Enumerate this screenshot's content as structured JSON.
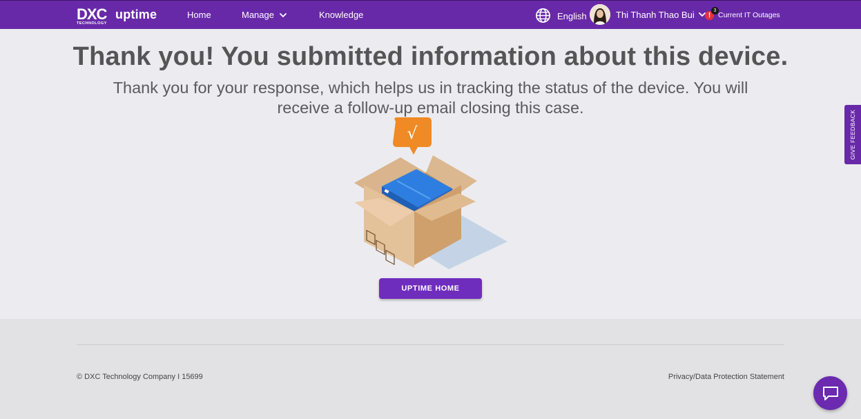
{
  "header": {
    "logo_brand": "DXC",
    "logo_sub": "TECHNOLOGY",
    "logo_product": "uptime",
    "nav": {
      "home": "Home",
      "manage": "Manage",
      "knowledge": "Knowledge"
    },
    "language": "English",
    "user_name": "Thi Thanh Thao Bui",
    "alert_glyph": "!",
    "alert_count": "3",
    "outages_label": "Current IT Outages",
    "icons": {
      "globe": "globe-icon",
      "manage_chevron": "chevron-down-icon",
      "user_chevron": "chevron-down-icon",
      "alert": "alert-icon"
    }
  },
  "main": {
    "title": "Thank you! You submitted information about this device.",
    "subtitle": "Thank you for your response, which helps us in tracking the status of the device. You will receive a follow-up email closing this case.",
    "check_glyph": "√",
    "button_label": "UPTIME HOME"
  },
  "feedback": {
    "label": "GIVE FEEDBACK"
  },
  "footer": {
    "copyright": "© DXC Technology Company I 15699",
    "privacy": "Privacy/Data Protection Statement"
  },
  "chat": {
    "icon": "chat-icon"
  },
  "colors": {
    "brand_purple": "#6829a8",
    "button_purple": "#6f2dbd",
    "alert_red": "#e5323c",
    "page_bg": "#ececf0",
    "footer_bg": "#e2e2e4",
    "check_orange": "#f08a24",
    "device_blue": "#2d7ee0"
  }
}
